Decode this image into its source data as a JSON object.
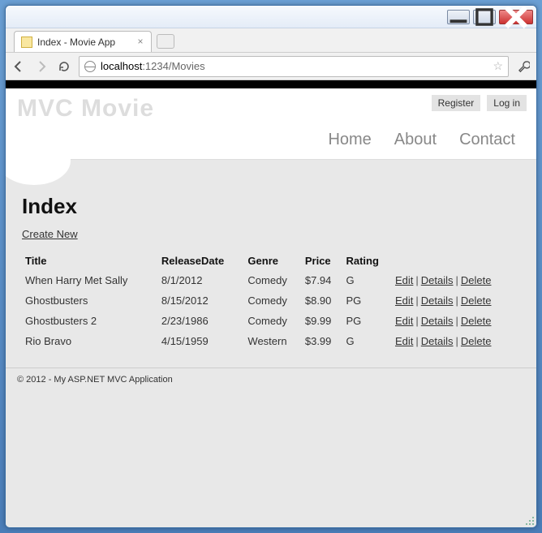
{
  "window": {
    "tab_title": "Index - Movie App",
    "url_host": "localhost",
    "url_port": ":1234",
    "url_path": "/Movies"
  },
  "header": {
    "brand": "MVC Movie",
    "auth": {
      "register": "Register",
      "login": "Log in"
    },
    "nav": {
      "home": "Home",
      "about": "About",
      "contact": "Contact"
    }
  },
  "page": {
    "heading": "Index",
    "create_link": "Create New",
    "columns": {
      "title": "Title",
      "release": "ReleaseDate",
      "genre": "Genre",
      "price": "Price",
      "rating": "Rating"
    },
    "actions": {
      "edit": "Edit",
      "details": "Details",
      "delete": "Delete"
    },
    "rows": [
      {
        "title": "When Harry Met Sally",
        "release": "8/1/2012",
        "genre": "Comedy",
        "price": "$7.94",
        "rating": "G"
      },
      {
        "title": "Ghostbusters",
        "release": "8/15/2012",
        "genre": "Comedy",
        "price": "$8.90",
        "rating": "PG"
      },
      {
        "title": "Ghostbusters 2",
        "release": "2/23/1986",
        "genre": "Comedy",
        "price": "$9.99",
        "rating": "PG"
      },
      {
        "title": "Rio Bravo",
        "release": "4/15/1959",
        "genre": "Western",
        "price": "$3.99",
        "rating": "G"
      }
    ]
  },
  "footer": {
    "text": "© 2012 - My ASP.NET MVC Application"
  }
}
